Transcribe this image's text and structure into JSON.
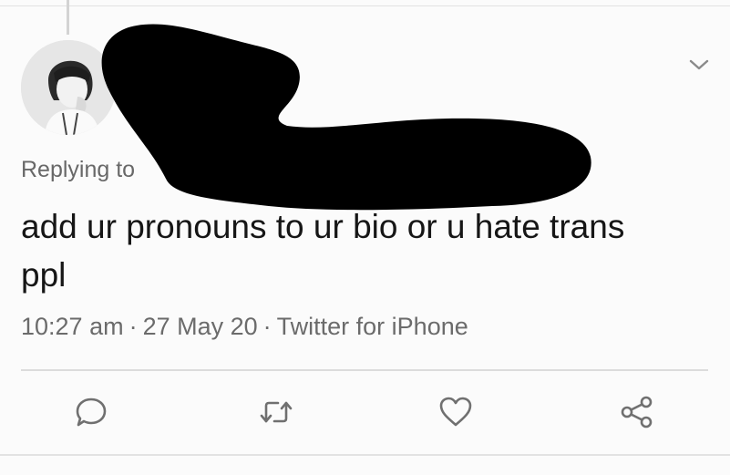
{
  "tweet": {
    "replying_prefix": "Replying to",
    "text": "add ur pronouns to ur bio or u hate trans ppl",
    "time": "10:27 am",
    "date": "27 May 20",
    "source": "Twitter for iPhone",
    "separator": "·"
  },
  "icons": {
    "more": "chevron-down-icon",
    "reply": "reply-icon",
    "retweet": "retweet-icon",
    "like": "heart-icon",
    "share": "share-icon"
  },
  "colors": {
    "background": "#fbfbfb",
    "text": "#161616",
    "muted": "#686868",
    "icon": "#707070",
    "redaction": "#000000"
  }
}
